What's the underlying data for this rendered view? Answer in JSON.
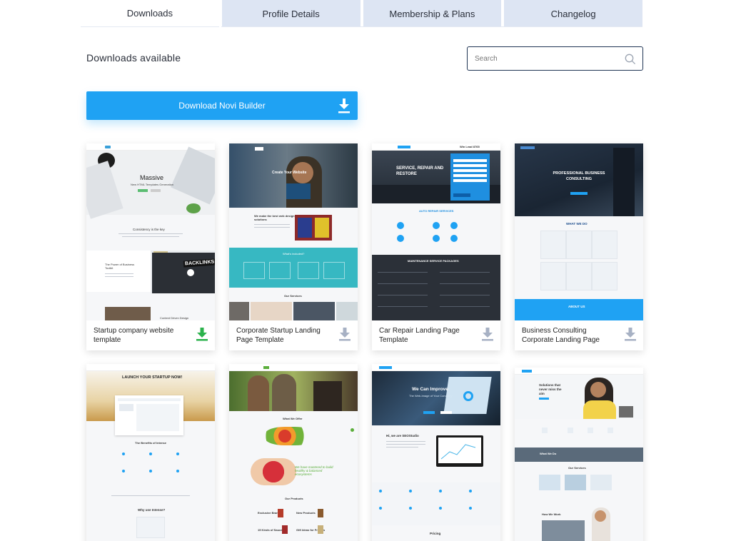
{
  "tabs": [
    {
      "label": "Downloads",
      "active": true
    },
    {
      "label": "Profile Details",
      "active": false
    },
    {
      "label": "Membership & Plans",
      "active": false
    },
    {
      "label": "Changelog",
      "active": false
    }
  ],
  "section_title": "Downloads available",
  "search": {
    "placeholder": "Search",
    "value": "",
    "icon": "search-icon"
  },
  "download_button": {
    "label": "Download Novi Builder",
    "icon": "download-arrow-icon"
  },
  "colors": {
    "accent": "#1fa2f3",
    "tab_bg": "#dde5f3",
    "download_green": "#2bb24c",
    "download_grey": "#a7b1c4",
    "teal": "#37b8c2"
  },
  "templates": [
    {
      "name": "Startup company website template",
      "download_icon": "download-icon-green",
      "thumb": {
        "hero_title": "Massive",
        "hero_sub": "New HTML Templates Generation",
        "section": "Consistency is the key",
        "side_title": "The Power of Business Toolkit",
        "screen_word": "BACKLINKS",
        "footer_label": "Content Driven Design"
      }
    },
    {
      "name": "Corporate Startup Landing Page Template",
      "download_icon": "download-icon-grey",
      "thumb": {
        "hero_title": "Create Your Website",
        "intro": "We make the best web design solutions",
        "band": "What's included?",
        "services": "Our Services"
      }
    },
    {
      "name": "Car Repair Landing Page Template",
      "download_icon": "download-icon-grey",
      "thumb": {
        "hero_title": "SERVICE, REPAIR AND RESTORE",
        "phone": "Win Lead 8765",
        "services": "AUTO REPAIR SERVICES",
        "packages": "MAINTENANCE SERVICE PACKAGES"
      }
    },
    {
      "name": "Business Consulting Corporate Landing Page",
      "download_icon": "download-icon-grey",
      "thumb": {
        "hero_title": "PROFESSIONAL BUSINESS CONSULTING",
        "what": "WHAT WE DO",
        "about": "ABOUT US"
      }
    },
    {
      "name": "",
      "thumb": {
        "hero_title": "LAUNCH YOUR STARTUP NOW!",
        "benefits": "The Benefits of Intense",
        "why": "Why use Intense?"
      }
    },
    {
      "name": "",
      "thumb": {
        "offer": "What We Offer",
        "quote": "We have mastered to build healthy & balanced ecosystems",
        "products": "Our Products",
        "p1": "Exclusive Brands",
        "p2": "New Products",
        "p3": "15 Kinds of Sauce",
        "p4": "Gift Ideas for Friends"
      }
    },
    {
      "name": "",
      "thumb": {
        "hero_title": "We Can Improve",
        "hero_sub": "The Web-Image of Your Company",
        "hi": "Hi, we are SEOStudio",
        "pricing": "Pricing"
      }
    },
    {
      "name": "",
      "thumb": {
        "hero_title": "Solutions that never miss the aim",
        "what": "What We Do",
        "services": "Our Services",
        "work": "How We Work"
      }
    }
  ]
}
